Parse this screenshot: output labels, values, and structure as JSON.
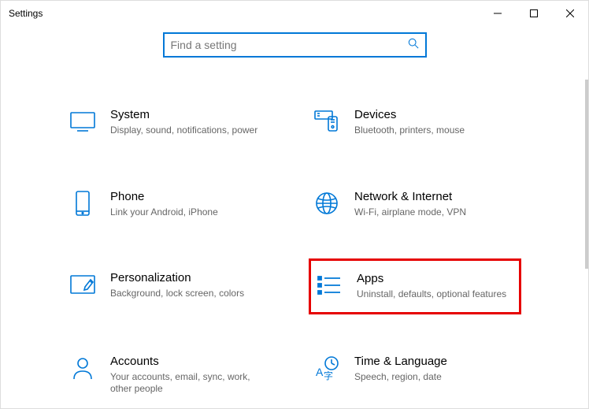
{
  "window": {
    "title": "Settings"
  },
  "search": {
    "placeholder": "Find a setting"
  },
  "categories": [
    {
      "id": "system",
      "title": "System",
      "desc": "Display, sound, notifications, power",
      "highlighted": false
    },
    {
      "id": "devices",
      "title": "Devices",
      "desc": "Bluetooth, printers, mouse",
      "highlighted": false
    },
    {
      "id": "phone",
      "title": "Phone",
      "desc": "Link your Android, iPhone",
      "highlighted": false
    },
    {
      "id": "network",
      "title": "Network & Internet",
      "desc": "Wi-Fi, airplane mode, VPN",
      "highlighted": false
    },
    {
      "id": "personalization",
      "title": "Personalization",
      "desc": "Background, lock screen, colors",
      "highlighted": false
    },
    {
      "id": "apps",
      "title": "Apps",
      "desc": "Uninstall, defaults, optional features",
      "highlighted": true
    },
    {
      "id": "accounts",
      "title": "Accounts",
      "desc": "Your accounts, email, sync, work, other people",
      "highlighted": false
    },
    {
      "id": "time",
      "title": "Time & Language",
      "desc": "Speech, region, date",
      "highlighted": false
    }
  ],
  "colors": {
    "accent": "#0078d7",
    "highlight": "#e60000"
  }
}
